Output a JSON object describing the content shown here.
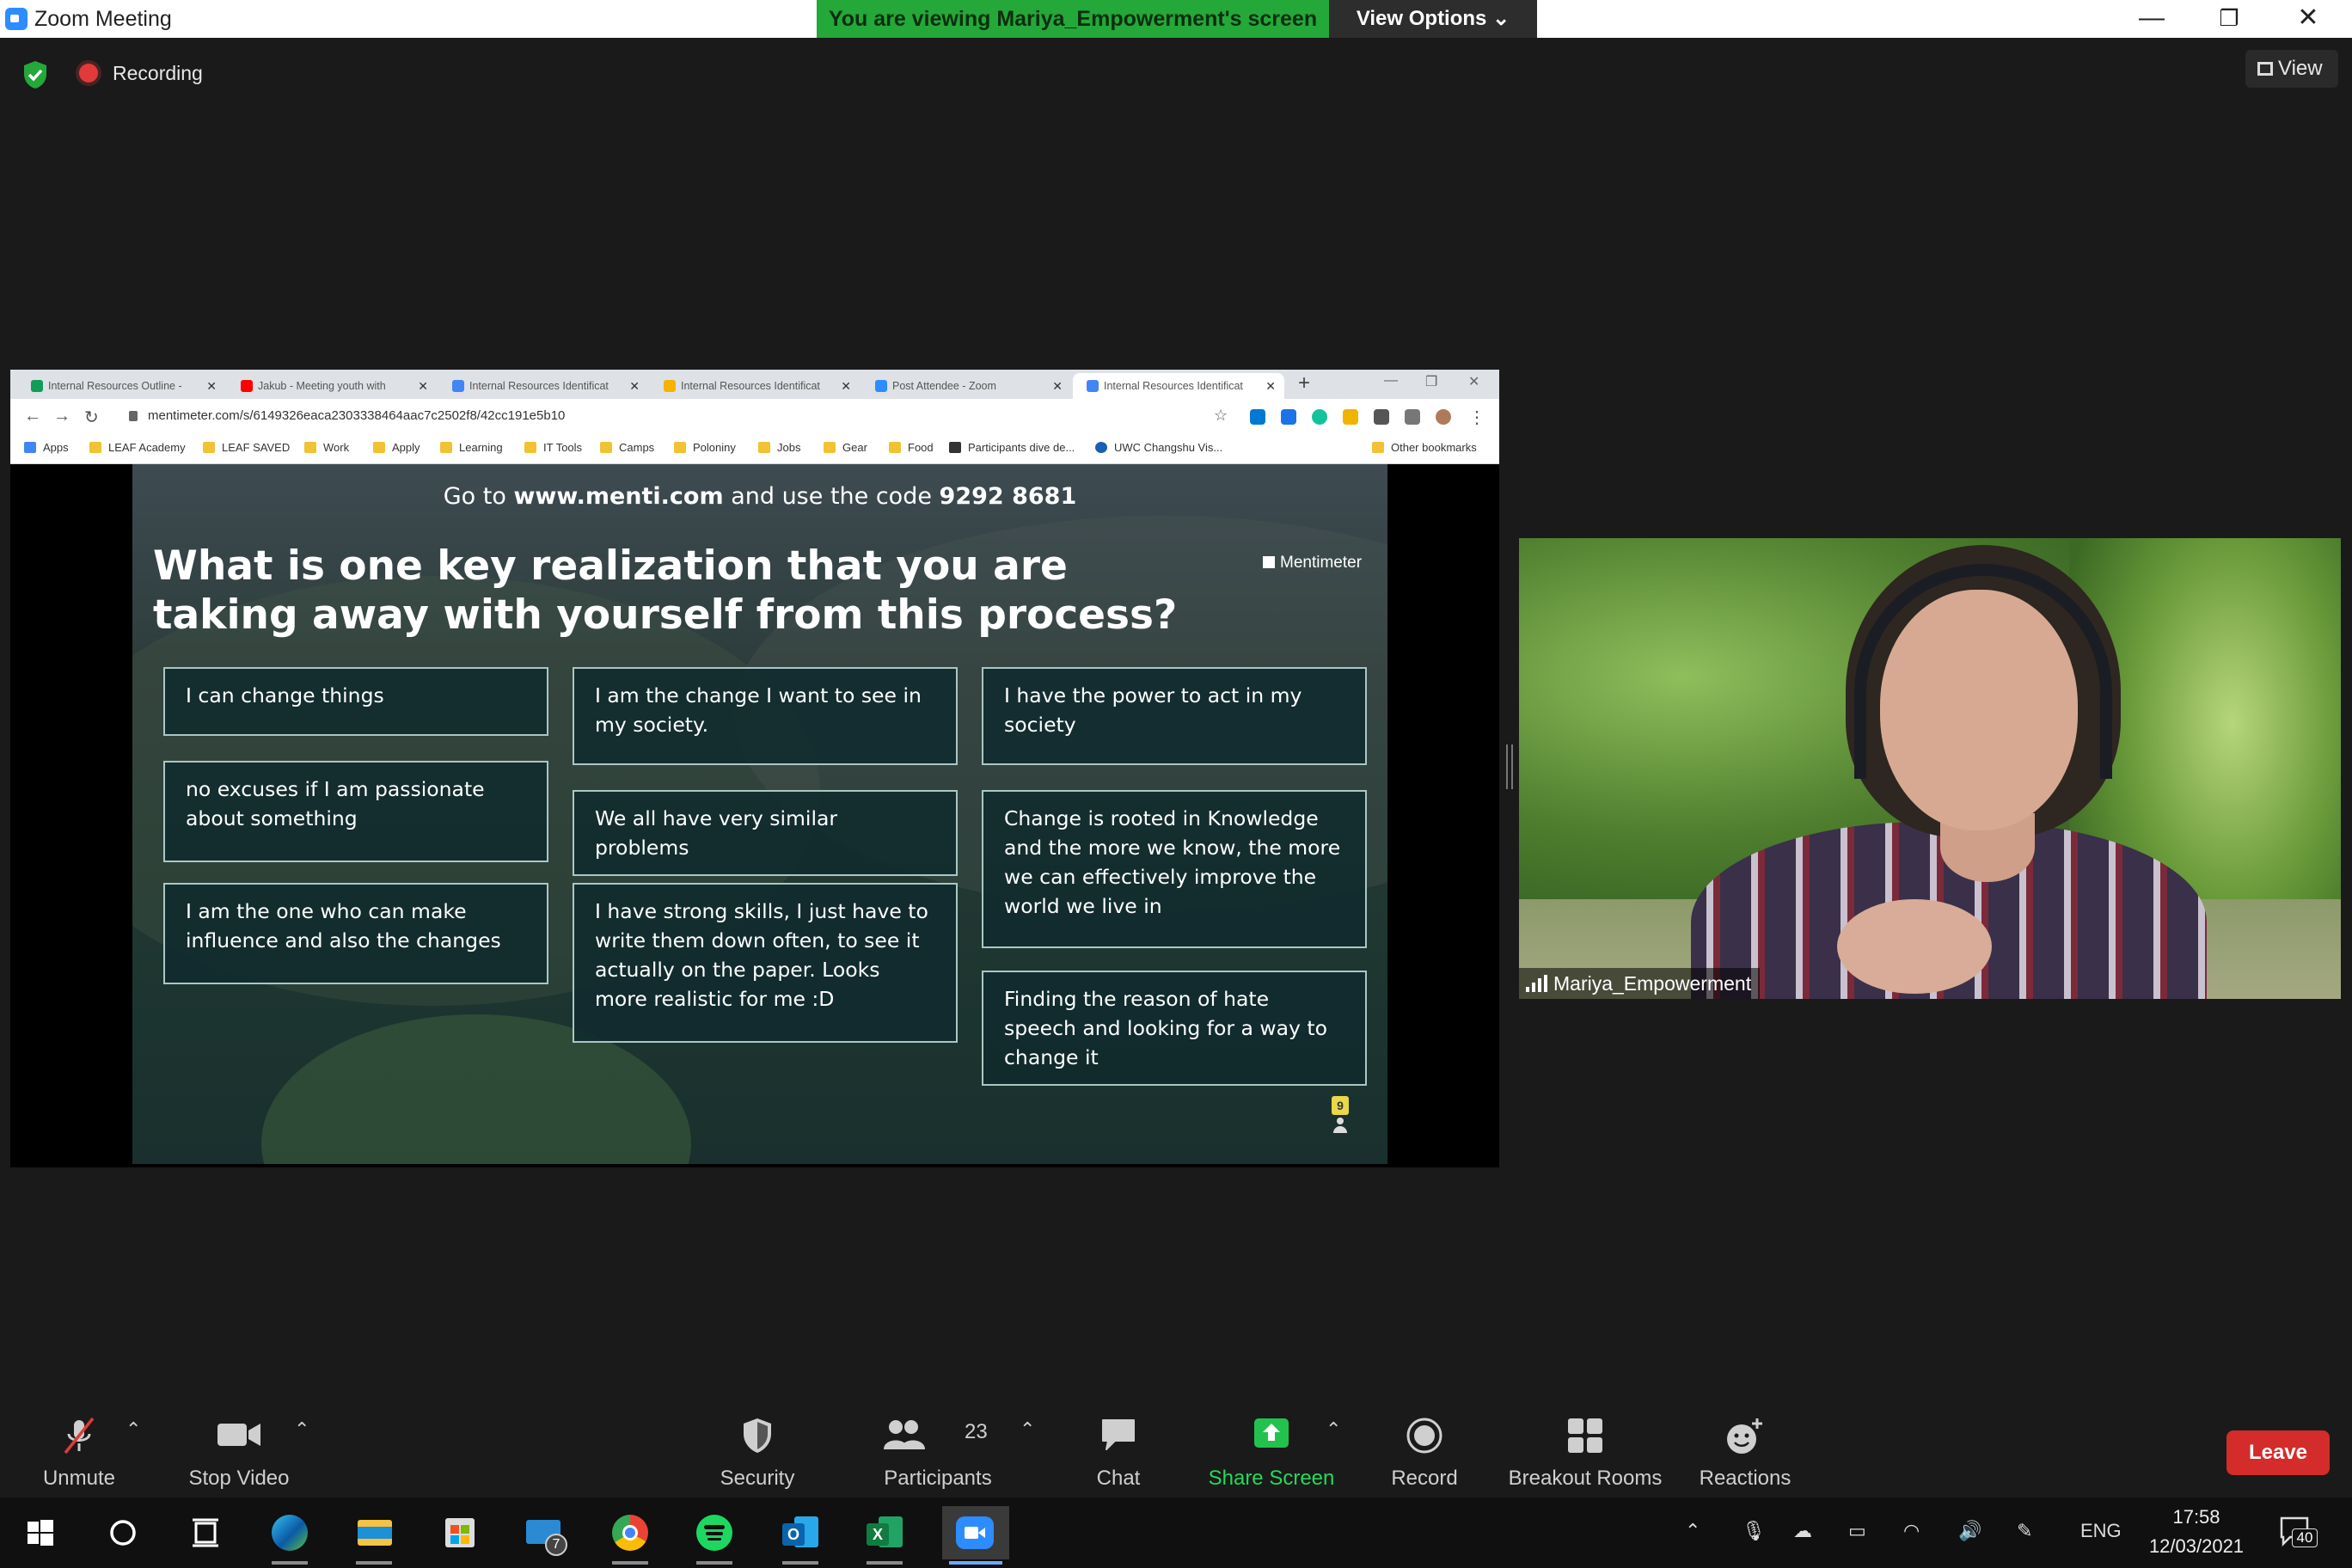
{
  "window": {
    "title": "Zoom Meeting",
    "banner": "You are viewing Mariya_Empowerment's screen",
    "view_options": "View Options",
    "minimize": "—",
    "restore": "❐",
    "close": "✕"
  },
  "meeting": {
    "recording_label": "Recording",
    "view_label": "View"
  },
  "browser": {
    "tabs": [
      {
        "label": "Internal Resources Outline - ",
        "color": "#0f9d58"
      },
      {
        "label": "Jakub - Meeting youth with ",
        "color": "#ff0000"
      },
      {
        "label": "Internal Resources Identificat",
        "color": "#4285f4"
      },
      {
        "label": "Internal Resources Identificat",
        "color": "#f4b400"
      },
      {
        "label": "Post Attendee - Zoom",
        "color": "#2d8cff"
      },
      {
        "label": "Internal Resources Identificat",
        "color": "#4285f4"
      }
    ],
    "new_tab": "+",
    "url": "mentimeter.com/s/6149326eaca2303338464aac7c2502f8/42cc191e5b10",
    "bookmarks": [
      "Apps",
      "LEAF Academy",
      "LEAF SAVED",
      "Work",
      "Apply",
      "Learning",
      "IT Tools",
      "Camps",
      "Poloniny",
      "Jobs",
      "Gear",
      "Food",
      "Participants dive de...",
      "UWC Changshu Vis...",
      "Other bookmarks"
    ]
  },
  "slide": {
    "code_prefix": "Go to ",
    "code_site": "www.menti.com",
    "code_middle": " and use the code ",
    "code_value": "9292 8681",
    "question": "What is one key realization that you are taking away with yourself from this process?",
    "logo": "Mentimeter",
    "badge": "9",
    "responses": [
      "I can change things",
      "I am the change I want to see in my society.",
      "I have the power to act in my society",
      "no excuses if I am passionate about something",
      "We all have very similar problems",
      "Change is rooted in Knowledge and the more we know, the more we can effectively improve the world we live in",
      "I am the one who can make influence and also the changes",
      "I have strong skills, I just have to write them down often, to see it actually on the paper. Looks more realistic for me :D",
      "Finding the reason of hate speech and looking for a way to change it"
    ]
  },
  "video": {
    "participant_name": "Mariya_Empowerment"
  },
  "toolbar": {
    "unmute": "Unmute",
    "stop_video": "Stop Video",
    "security": "Security",
    "participants": "Participants",
    "participants_count": "23",
    "chat": "Chat",
    "share_screen": "Share Screen",
    "record": "Record",
    "breakout_rooms": "Breakout Rooms",
    "reactions": "Reactions",
    "leave": "Leave",
    "share_color": "#23d959",
    "leave_color": "#d42b2b"
  },
  "taskbar": {
    "mail_badge": "7",
    "language": "ENG",
    "time": "17:58",
    "date": "12/03/2021",
    "notifications": "40"
  }
}
